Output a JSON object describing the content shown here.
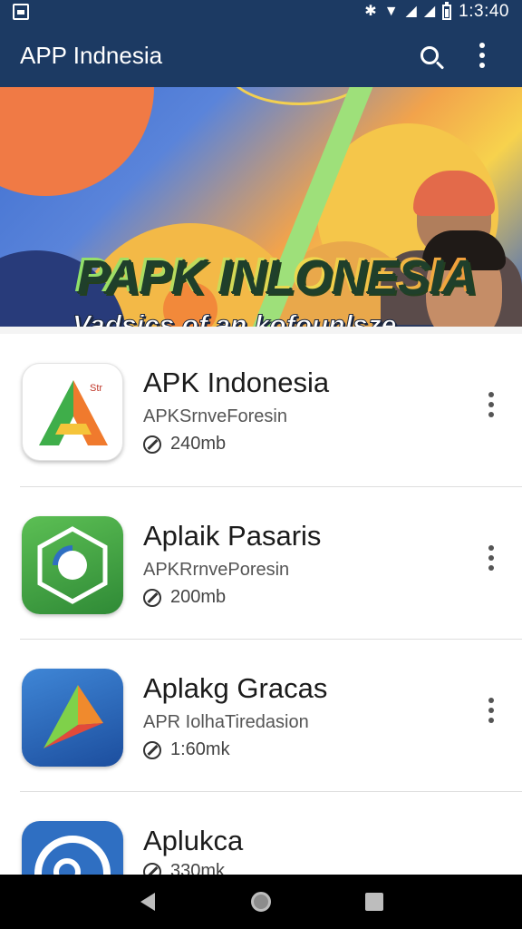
{
  "status_bar": {
    "time": "1:3:40"
  },
  "app_bar": {
    "title": "APP Indnesia"
  },
  "banner": {
    "title": "PAPK INLONESIA",
    "subtitle": "Vadsics of an kofounlsze"
  },
  "apps": [
    {
      "title": "APK Indonesia",
      "subtitle": "APKSrnveForesin",
      "size": "240mb",
      "icon": "orange-green-a-icon",
      "icon_badge": "Str"
    },
    {
      "title": "Aplaik Pasaris",
      "subtitle": "APKRrnvePoresin",
      "size": "200mb",
      "icon": "green-hexagon-icon"
    },
    {
      "title": "Aplakg Gracas",
      "subtitle": "APR IolhaTiredasion",
      "size": "1:60mk",
      "icon": "blue-triangle-icon"
    },
    {
      "title": "Aplukca",
      "size": "330mk",
      "icon": "blue-ring-icon"
    }
  ],
  "colors": {
    "app_bar": "#1c3a63",
    "list_bg": "#ffffff",
    "nav_bar": "#000000"
  }
}
